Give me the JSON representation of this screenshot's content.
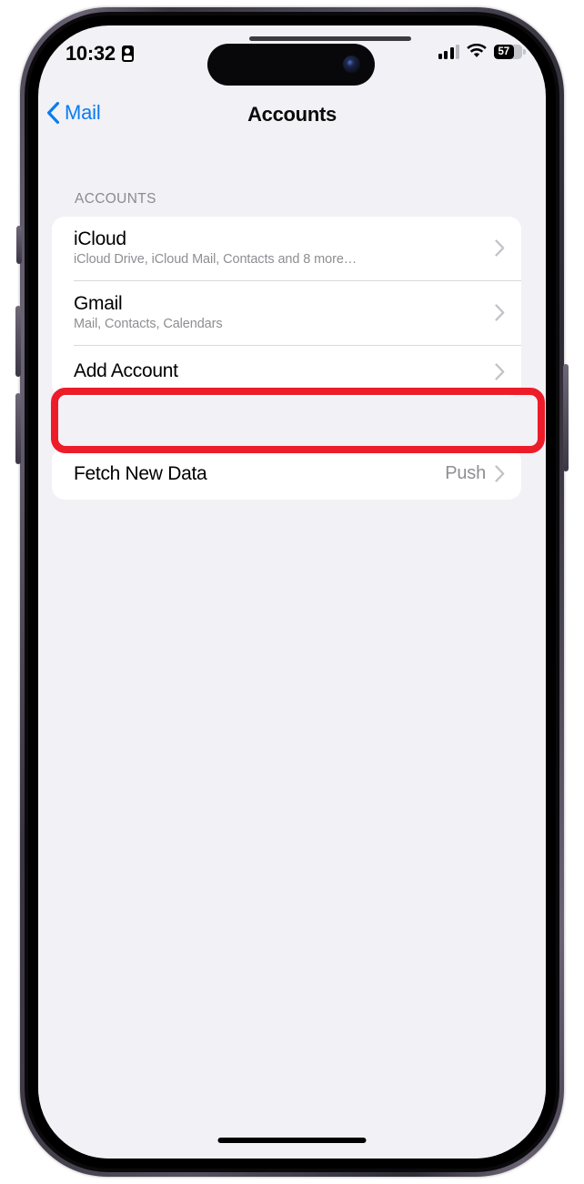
{
  "device": {
    "model": "iphone-14-pro",
    "frame_color": "#4a4453",
    "screen_background": "#f1f1f6"
  },
  "status_bar": {
    "time": "10:32",
    "recording_icon": "screen-record-icon",
    "cellular_icon": "cellular-bars-icon",
    "cellular_bars_active": 3,
    "wifi_icon": "wifi-icon",
    "battery_percent": "57",
    "battery_level": 57,
    "battery_icon": "battery-icon"
  },
  "nav_bar": {
    "back_icon": "chevron-left-icon",
    "back_label": "Mail",
    "title": "Accounts",
    "accent_color": "#0a7cf0"
  },
  "sections": [
    {
      "header": "ACCOUNTS",
      "rows": [
        {
          "title": "iCloud",
          "subtitle": "iCloud Drive, iCloud Mail, Contacts and 8 more…",
          "value": "",
          "chevron": "chevron-right-icon"
        },
        {
          "title": "Gmail",
          "subtitle": "Mail, Contacts, Calendars",
          "value": "",
          "chevron": "chevron-right-icon"
        },
        {
          "title": "Add Account",
          "subtitle": "",
          "value": "",
          "chevron": "chevron-right-icon"
        }
      ]
    },
    {
      "header": "",
      "rows": [
        {
          "title": "Fetch New Data",
          "subtitle": "",
          "value": "Push",
          "chevron": "chevron-right-icon"
        }
      ]
    }
  ],
  "annotation": {
    "type": "highlight-rectangle",
    "target": "Add Account",
    "color": "#ed1c29",
    "stroke_width": 8
  },
  "home_indicator": {
    "label": "home-indicator"
  }
}
